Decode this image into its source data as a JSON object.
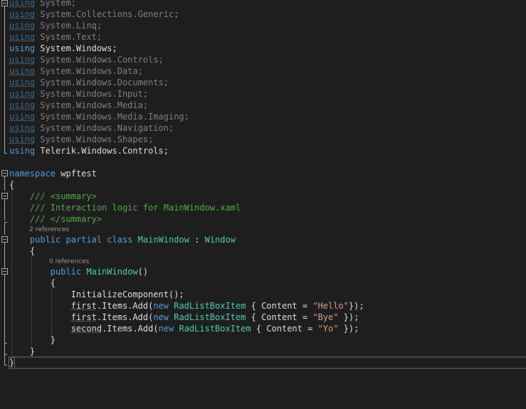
{
  "usings": [
    {
      "kw": "using",
      "ns": "System;",
      "dim": true
    },
    {
      "kw": "using",
      "ns": "System.Collections.Generic;",
      "dim": true
    },
    {
      "kw": "using",
      "ns": "System.Linq;",
      "dim": true
    },
    {
      "kw": "using",
      "ns": "System.Text;",
      "dim": true
    },
    {
      "kw": "using",
      "ns": "System.Windows;",
      "dim": false
    },
    {
      "kw": "using",
      "ns": "System.Windows.Controls;",
      "dim": true
    },
    {
      "kw": "using",
      "ns": "System.Windows.Data;",
      "dim": true
    },
    {
      "kw": "using",
      "ns": "System.Windows.Documents;",
      "dim": true
    },
    {
      "kw": "using",
      "ns": "System.Windows.Input;",
      "dim": true
    },
    {
      "kw": "using",
      "ns": "System.Windows.Media;",
      "dim": true
    },
    {
      "kw": "using",
      "ns": "System.Windows.Media.Imaging;",
      "dim": true
    },
    {
      "kw": "using",
      "ns": "System.Windows.Navigation;",
      "dim": true
    },
    {
      "kw": "using",
      "ns": "System.Windows.Shapes;",
      "dim": true
    },
    {
      "kw": "using",
      "ns": "Telerik.Windows.Controls;",
      "dim": false
    }
  ],
  "namespace": {
    "kw": "namespace",
    "name": "wpftest",
    "open": "{",
    "close": "}"
  },
  "doc": {
    "l1": "/// <summary>",
    "l2": "/// Interaction logic for MainWindow.xaml",
    "l3": "/// </summary>"
  },
  "codelens": {
    "class_refs": "2 references",
    "ctor_refs": "0 references"
  },
  "class_decl": {
    "mod1": "public",
    "mod2": "partial",
    "mod3": "class",
    "name": "MainWindow",
    "sep": " : ",
    "base": "Window"
  },
  "ctor_decl": {
    "mod": "public",
    "name": "MainWindow",
    "parens": "()"
  },
  "body": {
    "init": "InitializeComponent();",
    "lines": [
      {
        "target": "first",
        "mid": ".Items.Add(",
        "new": "new",
        "type": "RadListBoxItem",
        "pre": " { Content = ",
        "str": "\"Hello\"",
        "post": "});"
      },
      {
        "target": "first",
        "mid": ".Items.Add(",
        "new": "new",
        "type": "RadListBoxItem",
        "pre": " { Content = ",
        "str": "\"Bye\"",
        "post": " });"
      },
      {
        "target": "second",
        "mid": ".Items.Add(",
        "new": "new",
        "type": "RadListBoxItem",
        "pre": " { Content = ",
        "str": "\"Yo\"",
        "post": " });"
      }
    ]
  },
  "braces": {
    "open": "{",
    "close": "}"
  },
  "colors": {
    "background": "#1e1e1e",
    "keyword": "#569cd6",
    "type": "#4ec9b0",
    "string": "#d69d85",
    "comment": "#57a64a",
    "text": "#dcdcdc"
  }
}
